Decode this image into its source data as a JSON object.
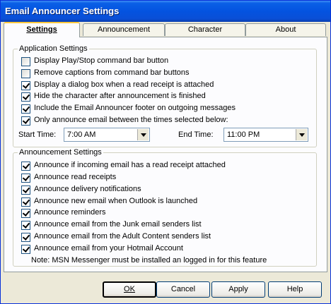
{
  "window": {
    "title": "Email Announcer Settings"
  },
  "tabs": [
    {
      "label": "Settings",
      "active": true
    },
    {
      "label": "Announcement",
      "active": false
    },
    {
      "label": "Character",
      "active": false
    },
    {
      "label": "About",
      "active": false
    }
  ],
  "application_settings": {
    "legend": "Application Settings",
    "options": [
      {
        "label": "Display Play/Stop command bar button",
        "checked": false
      },
      {
        "label": "Remove captions from command bar buttons",
        "checked": false
      },
      {
        "label": "Display a dialog box when a read receipt is attached",
        "checked": true
      },
      {
        "label": "Hide the character after announcement is finished",
        "checked": true
      },
      {
        "label": "Include the Email Announcer footer on outgoing messages",
        "checked": true
      },
      {
        "label": "Only announce email between the times selected below:",
        "checked": true
      }
    ],
    "start_time": {
      "label": "Start Time:",
      "value": "7:00 AM"
    },
    "end_time": {
      "label": "End Time:",
      "value": "11:00 PM"
    }
  },
  "announcement_settings": {
    "legend": "Announcement Settings",
    "options": [
      {
        "label": "Announce if incoming email has a read receipt attached",
        "checked": true
      },
      {
        "label": "Announce read receipts",
        "checked": true
      },
      {
        "label": "Announce delivery notifications",
        "checked": true
      },
      {
        "label": "Announce new email when Outlook is launched",
        "checked": true
      },
      {
        "label": "Announce reminders",
        "checked": true
      },
      {
        "label": "Announce email from the Junk email senders list",
        "checked": true
      },
      {
        "label": "Announce email from the Adult Content senders list",
        "checked": true
      },
      {
        "label": "Announce email from your Hotmail Account",
        "checked": true
      }
    ],
    "note": "Note:  MSN Messenger must be installed an logged in for this feature"
  },
  "buttons": {
    "ok": "OK",
    "cancel": "Cancel",
    "apply": "Apply",
    "help": "Help"
  }
}
